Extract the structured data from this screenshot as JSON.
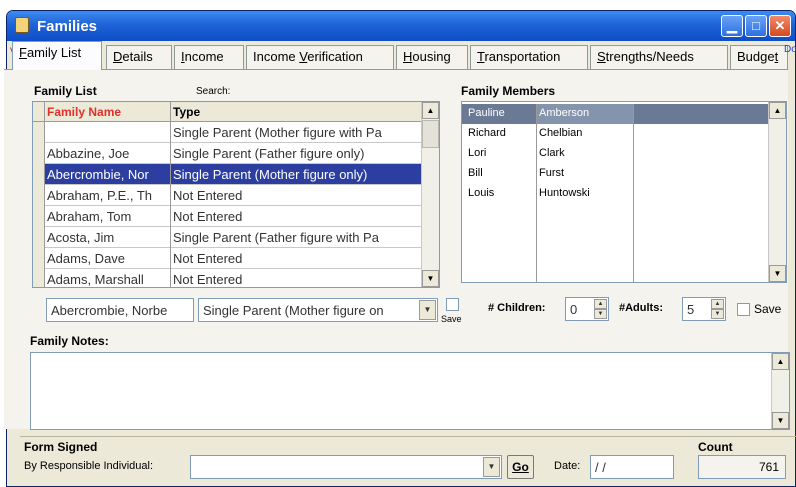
{
  "window": {
    "title": "Families",
    "doc_label": "Doc",
    "doc_mark": "V"
  },
  "tabs": [
    {
      "label": "Family List",
      "ul": "F",
      "rest": "amily List",
      "active": true
    },
    {
      "label": "Details",
      "ul": "D",
      "rest": "etails"
    },
    {
      "label": "Income",
      "ul": "I",
      "rest": "ncome"
    },
    {
      "label": "Income Verification",
      "pre": "Income ",
      "ul": "V",
      "rest": "erification"
    },
    {
      "label": "Housing",
      "ul": "H",
      "rest": "ousing"
    },
    {
      "label": "Transportation",
      "ul": "T",
      "rest": "ransportation"
    },
    {
      "label": "Strengths/Needs",
      "ul": "S",
      "rest": "trengths/Needs"
    },
    {
      "label": "Budget",
      "pre": "Budge",
      "ul": "t",
      "rest": ""
    }
  ],
  "family_list": {
    "section_label": "Family List",
    "search_label": "Search:",
    "col_name": "Family Name",
    "col_type": "Type",
    "rows": [
      {
        "name": "",
        "type": "Single Parent (Mother figure with Pa"
      },
      {
        "name": "Abbazine, Joe",
        "type": "Single Parent (Father figure only)"
      },
      {
        "name": "Abercrombie, Nor",
        "type": "Single Parent (Mother figure only)",
        "selected": true
      },
      {
        "name": "Abraham, P.E., Th",
        "type": "Not Entered"
      },
      {
        "name": "Abraham, Tom",
        "type": "Not Entered"
      },
      {
        "name": "Acosta, Jim",
        "type": "Single Parent (Father figure with Pa"
      },
      {
        "name": "Adams, Dave",
        "type": "Not Entered"
      },
      {
        "name": "Adams, Marshall",
        "type": "Not Entered"
      }
    ]
  },
  "family_members": {
    "section_label": "Family Members",
    "rows": [
      {
        "first": "Pauline",
        "last": "Amberson",
        "selected": true
      },
      {
        "first": "Richard",
        "last": "Chelbian"
      },
      {
        "first": "Lori",
        "last": "Clark"
      },
      {
        "first": "Bill",
        "last": "Furst"
      },
      {
        "first": "Louis",
        "last": "Huntowski"
      }
    ]
  },
  "edit_row": {
    "name_value": "Abercrombie, Norbe",
    "type_value": "Single Parent (Mother figure on",
    "save_label_small": "Save",
    "children_label": "# Children:",
    "children_value": "0",
    "adults_label": "#Adults:",
    "adults_value": "5",
    "save_label": "Save"
  },
  "notes": {
    "label": "Family Notes:",
    "value": ""
  },
  "form_signed": {
    "label": "Form Signed",
    "by_label": "By Responsible Individual:",
    "by_value": "",
    "go_label": "Go",
    "date_label": "Date:",
    "date_value": "/ /"
  },
  "count": {
    "label": "Count",
    "value": "761"
  }
}
